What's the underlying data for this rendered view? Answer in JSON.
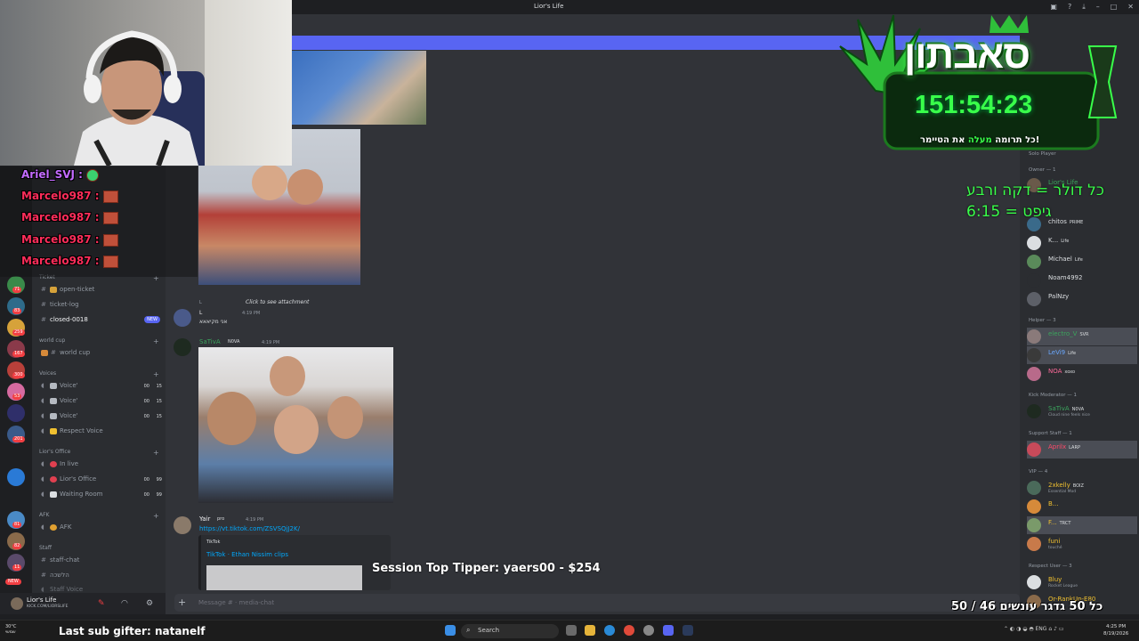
{
  "window": {
    "title": "Lior's Life"
  },
  "rail_badges": [
    "144",
    "71",
    "83",
    "259",
    "167",
    "300",
    "53",
    "201",
    "81",
    "82",
    "11"
  ],
  "rail_new": "NEW",
  "kick_chat": [
    {
      "user": "Ariel_SVJ :",
      "color": "#c36bff"
    },
    {
      "user": "Marcelo987 :",
      "color": "#ff2d5a"
    },
    {
      "user": "Marcelo987 :",
      "color": "#ff2d5a"
    },
    {
      "user": "Marcelo987 :",
      "color": "#ff2d5a"
    },
    {
      "user": "Marcelo987 :",
      "color": "#ff2d5a"
    }
  ],
  "channels": {
    "ticket_cat": "Ticket",
    "open_ticket": "open-ticket",
    "ticket_log": "ticket-log",
    "closed": "closed-0018",
    "new_badge": "NEW",
    "worldcup_cat": "world cup",
    "worldcup": "world cup",
    "voices_cat": "Voices",
    "voice1": "Voice'",
    "voice2": "Voice'",
    "voice3": "Voice'",
    "respect_voice": "Respect Voice",
    "count_00": "00",
    "count_15": "15",
    "count_99": "99",
    "office_cat": "Lior's Office",
    "in_live": "In live",
    "liors_office": "Lior's Office",
    "waiting_room": "Waiting Room",
    "afk_cat": "AFK",
    "afk": "AFK",
    "staff_cat": "Staff",
    "staff_chat": "staff-chat",
    "staff2": "הלשכה",
    "staff_voice": "Staff Voice"
  },
  "user_panel": {
    "name": "Lior's Life",
    "status": "KICK.COM/LIORSLIFE"
  },
  "messages": {
    "m1_user": "L",
    "m1_attach": "Click to see attachment",
    "m1_time": "4:19 PM",
    "m1_text": "אני מקיאאא",
    "m2_user": "SaTivA",
    "m2_tag": "N0VA",
    "m2_time": "4:19 PM",
    "m3_user": "Yair",
    "m3_tag": "pro",
    "m3_time": "4:19 PM",
    "m3_link": "https://vt.tiktok.com/ZSVSQjJ2K/",
    "embed_provider": "TikTok",
    "embed_title": "TikTok · Ethan Nissim clips"
  },
  "input": {
    "placeholder": "Message #   · media-chat"
  },
  "overlay": {
    "brand": "סאבתון",
    "timer": "151:54:23",
    "subtitle_pre": "כל תרומה",
    "subtitle_green": "מעלה",
    "subtitle_post": "את הטיימר!",
    "rule1": "כל דולר = דקה ורבע",
    "rule2": "גיפט = 6:15",
    "tipper": "Session Top Tipper: yaers00 - $254",
    "goal": "כל 50 גדגר עונשים 46 / 50",
    "last_sub": "Last sub gifter: natanelf"
  },
  "members": {
    "owner_cat": "Owner — 1",
    "owner_name": "Lior's Life",
    "chitos": "chitos",
    "chitos_tag": "PRIME",
    "k": "K...",
    "k_tag": "Life",
    "michael": "Michael",
    "michael_tag": "Life",
    "noam": "Noam4992",
    "palnzy": "PalNzy",
    "helper_cat": "Helper — 3",
    "electro": "electro_V",
    "electro_tag": "SVR",
    "levi": "LeVi9",
    "levi_tag": "Life",
    "noa": "NOA",
    "noa_tag": "xoxo",
    "kickmod_cat": "Kick Moderator — 1",
    "sativa": "SaTivA",
    "sativa_tag": "N0VA",
    "sativa_status": "Cloud nine feels nice",
    "support_cat": "Support Staff — 1",
    "aprilx": "Aprilx",
    "aprilx_tag": "LARP",
    "vip_cat": "VIP — 4",
    "twox": "2xkelly",
    "twox_tag": "BOIZ",
    "twox_status": "Essential Mod",
    "b": "B...",
    "f": "F...",
    "f_tag": "TRCT",
    "funi": "funi",
    "funi_status": "touché",
    "respect_cat": "Respect User — 3",
    "bluy": "Bluy",
    "bluy_status": "Rocket League",
    "orrank": "Or-RankUp-E80",
    "solo_player": "Solo Player"
  },
  "taskbar": {
    "weather_temp": "30°C",
    "weather_desc": "שמשי",
    "search": "Search",
    "lang": "ENG",
    "time": "4:25 PM",
    "date": "8/19/2026"
  }
}
